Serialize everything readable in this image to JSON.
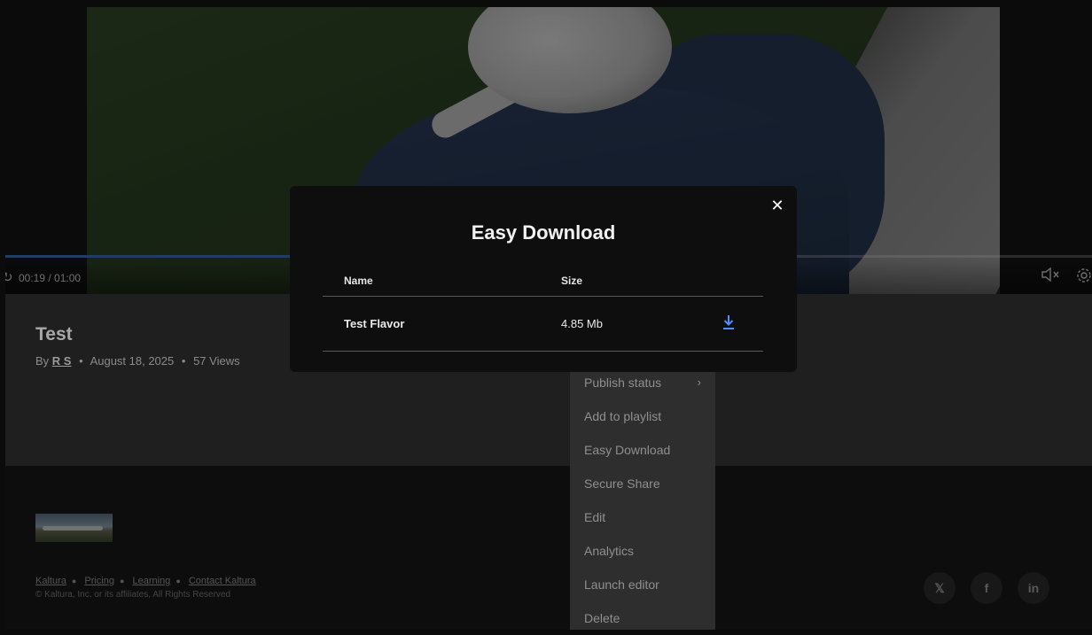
{
  "player": {
    "time": "00:19 / 01:00",
    "progress": 0.32,
    "icons": {
      "replay": "replay-icon",
      "volume": "volume-muted-icon",
      "settings": "gear-icon"
    }
  },
  "entry": {
    "title": "Test",
    "by_prefix": "By",
    "author": "R S",
    "date": "August 18, 2025",
    "views": "57 Views"
  },
  "menu": {
    "items": [
      {
        "label": "Publish status",
        "submenu": true
      },
      {
        "label": "Add to playlist"
      },
      {
        "label": "Easy Download"
      },
      {
        "label": "Secure Share"
      },
      {
        "label": "Edit"
      },
      {
        "label": "Analytics"
      },
      {
        "label": "Launch editor"
      },
      {
        "label": "Delete"
      }
    ]
  },
  "modal": {
    "title": "Easy Download",
    "close": "✕",
    "headers": {
      "name": "Name",
      "size": "Size"
    },
    "rows": [
      {
        "name": "Test Flavor",
        "size": "4.85 Mb"
      }
    ],
    "accent": "#4d8fff"
  },
  "footer": {
    "links": [
      "Kaltura",
      "Pricing",
      "Learning",
      "Contact Kaltura"
    ],
    "copyright": "© Kaltura, Inc. or its affiliates, All Rights Reserved",
    "social": [
      {
        "glyph": "𝕏",
        "icon": "x-icon"
      },
      {
        "glyph": "f",
        "icon": "facebook-icon"
      },
      {
        "glyph": "in",
        "icon": "linkedin-icon"
      }
    ]
  }
}
